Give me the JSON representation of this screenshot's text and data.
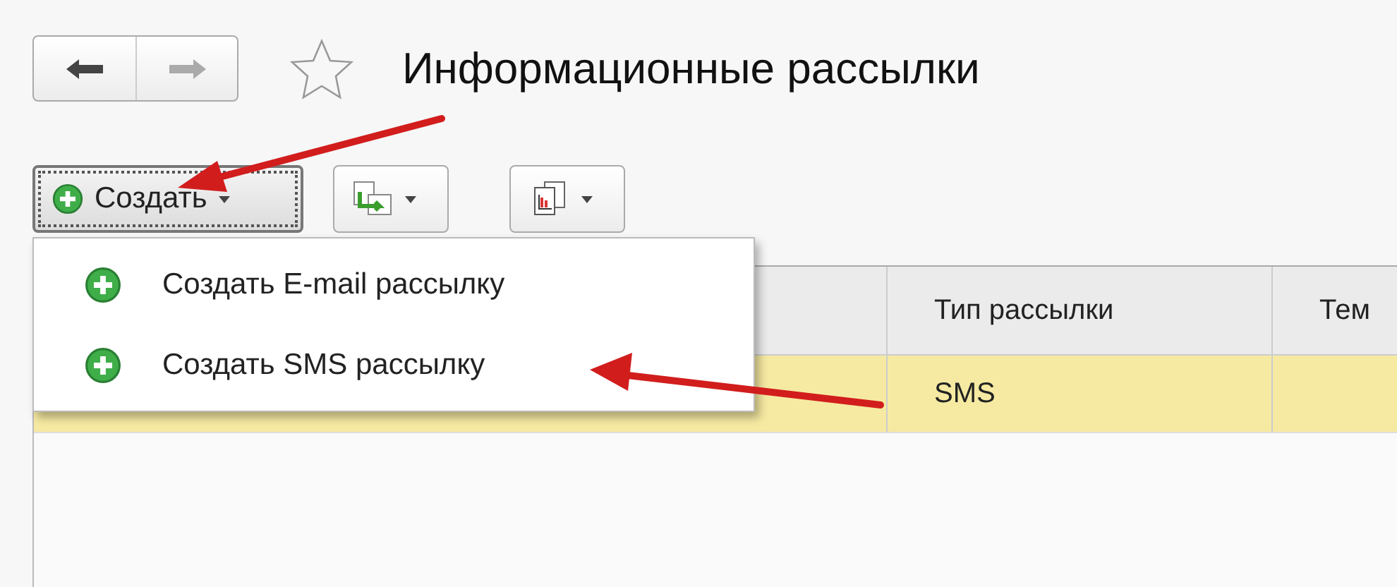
{
  "navigation": {
    "back_disabled": false,
    "forward_disabled": true
  },
  "favorite": {
    "on": false
  },
  "title": "Информационные рассылки",
  "create_button": {
    "label": "Создать",
    "focused": true
  },
  "dropdown": {
    "items": [
      {
        "label": "Создать E-mail рассылку"
      },
      {
        "label": "Создать SMS рассылку"
      }
    ]
  },
  "table": {
    "columns": [
      {
        "label": "Тип рассылки"
      },
      {
        "label": "Тем"
      }
    ],
    "rows": [
      {
        "selected": true,
        "type": "SMS"
      }
    ]
  }
}
